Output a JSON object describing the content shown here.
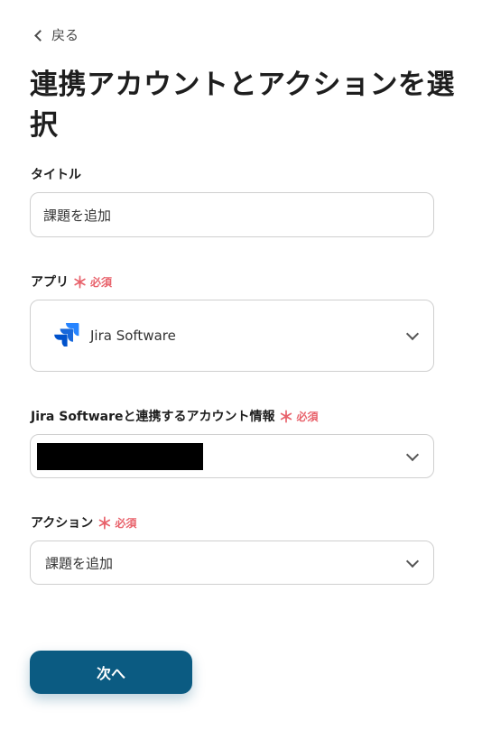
{
  "nav": {
    "back_label": "戻る"
  },
  "page": {
    "title": "連携アカウントとアクションを選択"
  },
  "required_marker": {
    "star": "＊",
    "label": "必須"
  },
  "form": {
    "title_field": {
      "label": "タイトル",
      "value": "課題を追加"
    },
    "app_field": {
      "label": "アプリ",
      "value": "Jira Software",
      "icon": "jira-software-icon"
    },
    "account_field": {
      "label": "Jira Softwareと連携するアカウント情報",
      "value": ""
    },
    "action_field": {
      "label": "アクション",
      "value": "課題を追加"
    }
  },
  "buttons": {
    "next_label": "次へ"
  },
  "colors": {
    "primary": "#0b5b82",
    "required": "#e8626b",
    "jira_blue": "#2684ff"
  }
}
